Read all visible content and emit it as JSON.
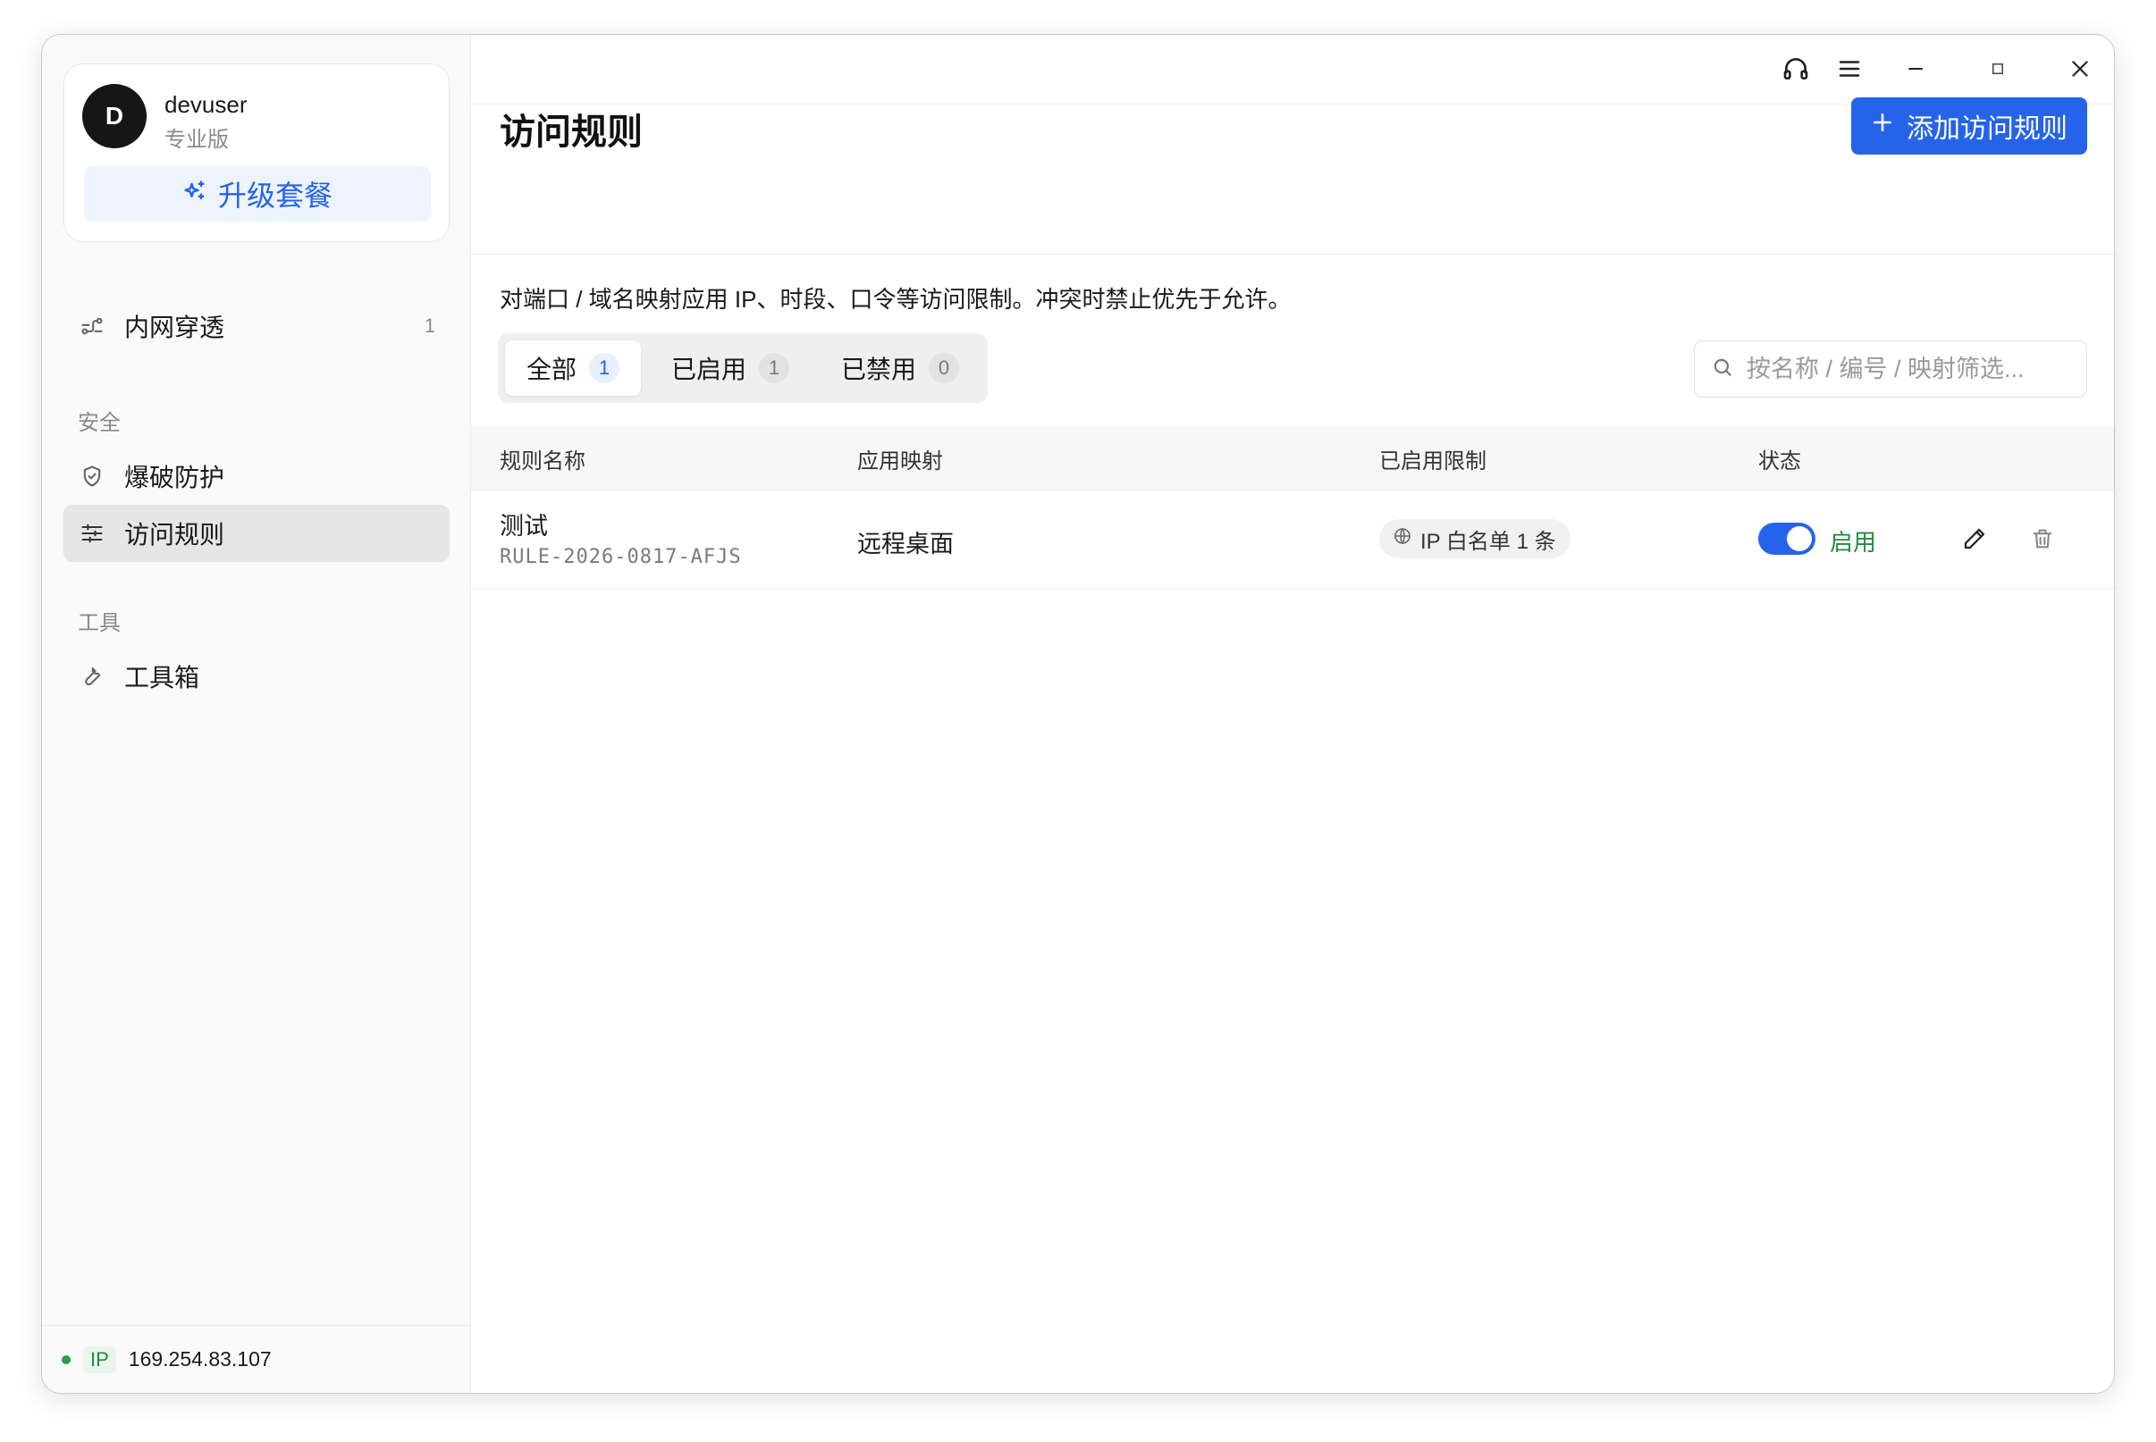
{
  "user": {
    "initial": "D",
    "name": "devuser",
    "plan": "专业版",
    "upgrade_label": "升级套餐"
  },
  "sidebar": {
    "items": [
      {
        "label": "内网穿透",
        "count": "1",
        "icon": "tunnel-icon"
      },
      {
        "label": "爆破防护",
        "icon": "shield-icon"
      },
      {
        "label": "访问规则",
        "icon": "sliders-icon",
        "active": true
      },
      {
        "label": "工具箱",
        "icon": "wrench-icon"
      }
    ],
    "sections": {
      "security": "安全",
      "tools": "工具"
    }
  },
  "footer": {
    "ip_label": "IP",
    "ip_value": "169.254.83.107"
  },
  "header": {
    "title": "访问规则",
    "add_label": "添加访问规则"
  },
  "description": "对端口 / 域名映射应用 IP、时段、口令等访问限制。冲突时禁止优先于允许。",
  "tabs": [
    {
      "label": "全部",
      "count": "1"
    },
    {
      "label": "已启用",
      "count": "1"
    },
    {
      "label": "已禁用",
      "count": "0"
    }
  ],
  "search": {
    "placeholder": "按名称 / 编号 / 映射筛选..."
  },
  "table": {
    "columns": [
      "规则名称",
      "应用映射",
      "已启用限制",
      "状态"
    ],
    "rows": [
      {
        "name": "测试",
        "id": "RULE-2026-0817-AFJS",
        "mapping": "远程桌面",
        "limit": "IP 白名单 1 条",
        "enabled": true,
        "status": "启用"
      }
    ]
  },
  "colors": {
    "accent": "#2563eb",
    "success": "#1f8a3f"
  }
}
